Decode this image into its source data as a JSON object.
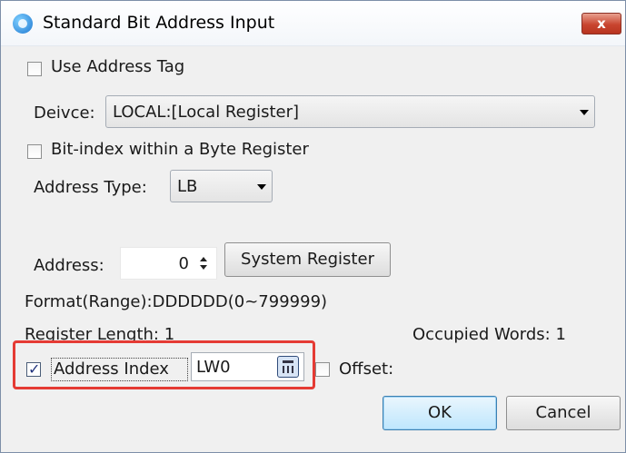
{
  "window": {
    "title": "Standard Bit Address Input",
    "close_label": "x"
  },
  "use_address_tag": {
    "label": "Use Address Tag",
    "checked": false
  },
  "device": {
    "label": "Deivce:",
    "value": "LOCAL:[Local Register]"
  },
  "bit_index": {
    "label": "Bit-index within a Byte Register",
    "checked": false
  },
  "address_type": {
    "label": "Address Type:",
    "value": "LB"
  },
  "address": {
    "label": "Address:",
    "value": "0"
  },
  "system_register_button": "System Register",
  "format_text": "Format(Range):DDDDDD(0~799999)",
  "register_length": "Register Length: 1",
  "occupied_words": "Occupied Words: 1",
  "address_index": {
    "label": "Address Index",
    "checked": true,
    "value": "LW0"
  },
  "offset": {
    "label": "Offset:",
    "checked": false
  },
  "buttons": {
    "ok": "OK",
    "cancel": "Cancel"
  },
  "icons": {
    "app": "app-icon",
    "close": "close-icon",
    "calculator": "calculator-icon",
    "dropdown": "chevron-down-icon"
  },
  "colors": {
    "highlight": "#e53b34",
    "close_button": "#c9452f"
  }
}
